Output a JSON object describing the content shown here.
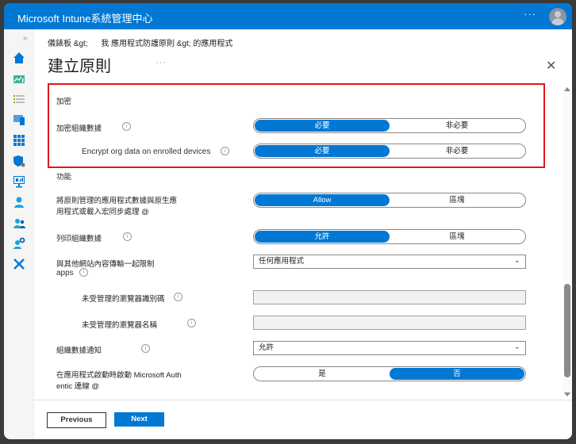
{
  "app": {
    "title": "Microsoft Intune系統管理中心",
    "more_label": "···",
    "avatar_icon": "user-avatar-icon"
  },
  "leftnav": {
    "expand_label": "»",
    "items": [
      {
        "icon": "home-icon",
        "color": "#0078d4"
      },
      {
        "icon": "dashboard-icon",
        "color": "#3fb29c"
      },
      {
        "icon": "all-services-icon",
        "color": "#7fba00"
      },
      {
        "icon": "devices-icon",
        "color": "#0078d4"
      },
      {
        "icon": "apps-icon",
        "color": "#0078d4"
      },
      {
        "icon": "endpoint-security-icon",
        "color": "#0078d4"
      },
      {
        "icon": "reports-icon",
        "color": "#0078d4"
      },
      {
        "icon": "users-icon",
        "color": "#1ba1e2"
      },
      {
        "icon": "groups-icon",
        "color": "#1ba1e2"
      },
      {
        "icon": "tenant-admin-icon",
        "color": "#1ba1e2"
      },
      {
        "icon": "troubleshooting-icon",
        "color": "#0078d4"
      }
    ]
  },
  "header": {
    "breadcrumb": "儀錶板 &gt;      我 應用程式防護原則 &gt; 的應用程式",
    "title": "建立原則",
    "title_more": "···",
    "close_label": "✕"
  },
  "sections": {
    "encryption": {
      "heading": "加密",
      "rows": [
        {
          "label": "加密組織數據",
          "options": [
            "必要",
            "非必要"
          ],
          "selected": 0
        },
        {
          "label": "Encrypt org data on enrolled devices",
          "options": [
            "必要",
            "非必要"
          ],
          "selected": 0
        }
      ]
    },
    "functionality": {
      "heading": "功能",
      "sync_row": {
        "label_line1": "將原則管理的應用程式數據與原生應",
        "label_line2": "用程式或載入宏同步處理 @",
        "options": [
          "Allow",
          "區塊"
        ],
        "selected": 0
      },
      "print_row": {
        "label": "列印組織數據",
        "options": [
          "允許",
          "區塊"
        ],
        "selected": 0
      },
      "transfer_row": {
        "label_line1": "與其他網站內容傳輸一起限制",
        "label_line2": "apps",
        "value": "任何應用程式",
        "chevron": "⌄"
      },
      "browser_id_row": {
        "label": "未受管理的瀏覽器識別碼",
        "value": ""
      },
      "browser_name_row": {
        "label": "未受管理的瀏覽器名稱",
        "value": ""
      },
      "notification_row": {
        "label": "組織數據通知",
        "value": "允許",
        "chevron": "⌄"
      },
      "authenticator_row": {
        "label_line1": "在應用程式啟動時啟動 Microsoft Auth",
        "label_line2": "entic 連線 @",
        "options": [
          "是",
          "否"
        ],
        "selected": 1
      }
    }
  },
  "footer": {
    "previous_label": "Previous",
    "next_label": "Next"
  },
  "colors": {
    "brand": "#0078d4",
    "highlight_border": "#e0161f"
  }
}
